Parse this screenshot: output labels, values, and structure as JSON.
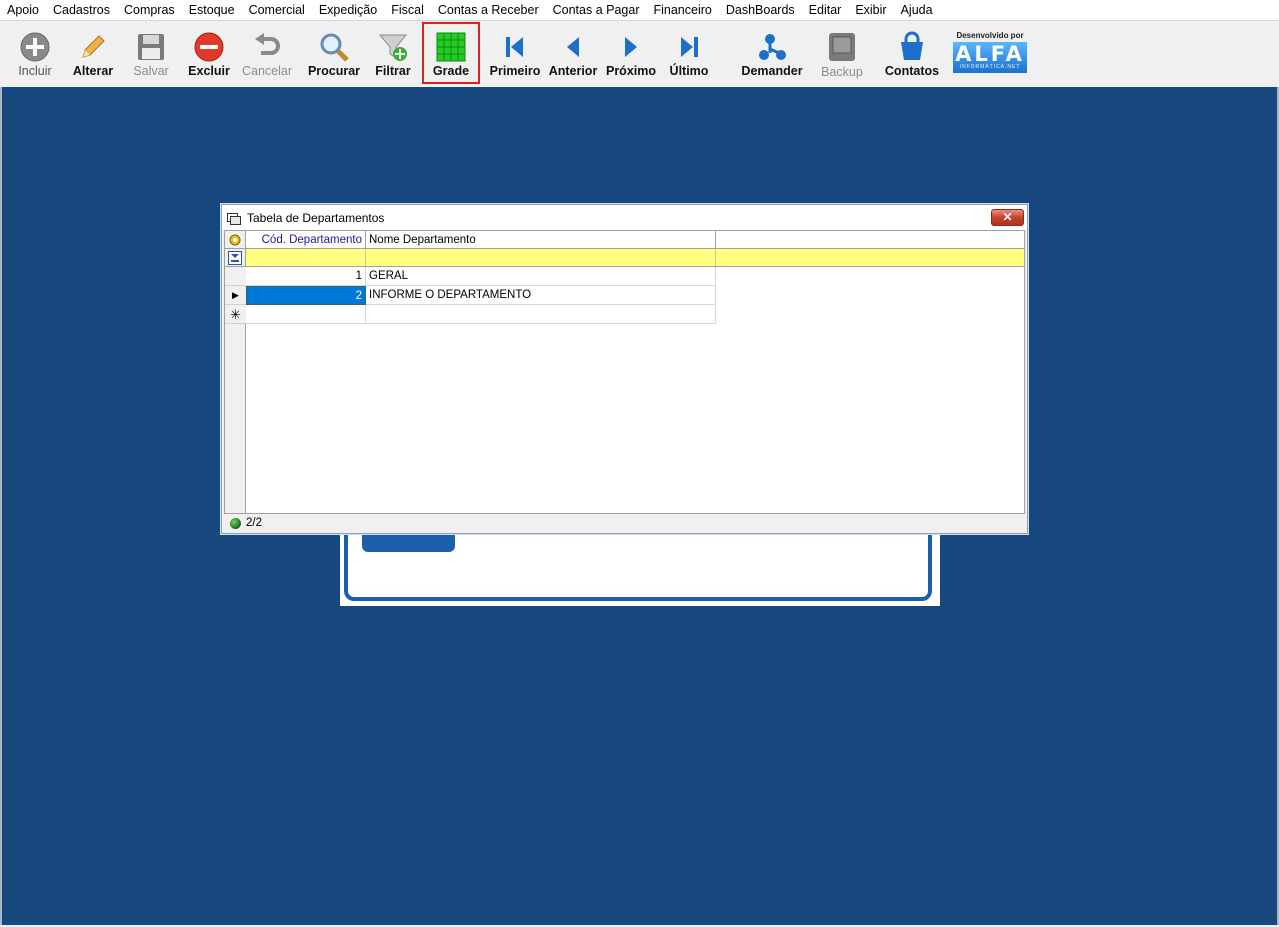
{
  "menu": [
    "Apoio",
    "Cadastros",
    "Compras",
    "Estoque",
    "Comercial",
    "Expedição",
    "Fiscal",
    "Contas a Receber",
    "Contas a Pagar",
    "Financeiro",
    "DashBoards",
    "Editar",
    "Exibir",
    "Ajuda"
  ],
  "toolbar": {
    "incluir": "Incluir",
    "alterar": "Alterar",
    "salvar": "Salvar",
    "excluir": "Excluir",
    "cancelar": "Cancelar",
    "procurar": "Procurar",
    "filtrar": "Filtrar",
    "grade": "Grade",
    "primeiro": "Primeiro",
    "anterior": "Anterior",
    "proximo": "Próximo",
    "ultimo": "Último",
    "demander": "Demander",
    "backup": "Backup",
    "contatos": "Contatos"
  },
  "brand": {
    "caption": "Desenvolvido por",
    "logo_text": "ALFA",
    "logo_sub": "INFORMÁTICA.NET"
  },
  "dialog": {
    "title": "Tabela de Departamentos",
    "close_label": "✕",
    "columns": [
      "Cód. Departamento",
      "Nome Departamento"
    ],
    "rows": [
      {
        "cod": "1",
        "nome": "GERAL"
      },
      {
        "cod": "2",
        "nome": "INFORME O DEPARTAMENTO"
      }
    ],
    "status": "2/2"
  },
  "colors": {
    "desktop": "#17487d",
    "filter_row": "#ffff80",
    "selection": "#0078d7",
    "grade_icon": "#22cc22"
  }
}
